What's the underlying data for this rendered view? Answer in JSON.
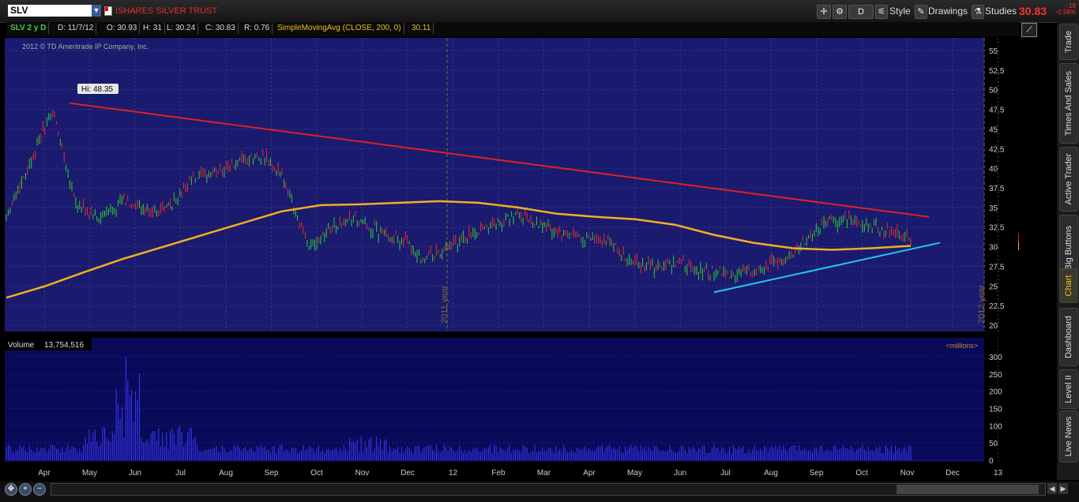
{
  "toolbar": {
    "symbol": "SLV",
    "description": "ISHARES SILVER TRUST",
    "d_button": "D",
    "style_label": "Style",
    "drawings_label": "Drawings",
    "studies_label": "Studies",
    "last_price": "30.83",
    "change": "-.18",
    "change_pct": "-0.58%"
  },
  "infobar": {
    "period": "SLV 2 y D",
    "date": "D: 11/7/12",
    "open": "O: 30.93",
    "high": "H: 31",
    "low": "L: 30.24",
    "close": "C: 30.83",
    "range": "R: 0.76",
    "study": "SimpleMovingAvg (CLOSE, 200, 0)",
    "study_value": "30.11"
  },
  "chart": {
    "copyright": "2012 © TD Ameritrade IP Company, Inc.",
    "hi_label": "Hi: 48.35",
    "year_2011": "2011 year",
    "year_2012": "2012 year",
    "price_label": "30.83",
    "sma_label": "30.11",
    "volume_label": "Volume",
    "volume_value": "13,754,516",
    "millions_label": "<millions>",
    "price_ticks": [
      "55",
      "52.5",
      "50",
      "47.5",
      "45",
      "42.5",
      "40",
      "37.5",
      "35",
      "32.5",
      "30",
      "27.5",
      "25",
      "22.5",
      "20"
    ],
    "volume_ticks": [
      "300",
      "250",
      "200",
      "150",
      "100",
      "50",
      "0"
    ],
    "x_labels": [
      "Apr",
      "May",
      "Jun",
      "Jul",
      "Aug",
      "Sep",
      "Oct",
      "Nov",
      "Dec",
      "12",
      "Feb",
      "Mar",
      "Apr",
      "May",
      "Jun",
      "Jul",
      "Aug",
      "Sep",
      "Oct",
      "Nov",
      "Dec",
      "13"
    ],
    "colors": {
      "background": "#1a1a6e",
      "grid": "#3a3a8a",
      "up": "#30d030",
      "down": "#e03030",
      "sma": "#f0b020",
      "resistance": "#e02020",
      "support": "#20c8f0",
      "volume": "#3a3aff"
    }
  },
  "chart_data": {
    "type": "line",
    "ylim": [
      20,
      56
    ],
    "hi": 48.35,
    "last": 30.83,
    "sma200_last": 30.11,
    "resistance_line": [
      {
        "x": "Apr 2011",
        "y": 48.3
      },
      {
        "x": "Nov 2012",
        "y": 33.8
      }
    ],
    "support_line": [
      {
        "x": "Jul 2012",
        "y": 24.2
      },
      {
        "x": "Nov 2012",
        "y": 30.5
      }
    ],
    "close_series": [
      {
        "x": "Mar 2011",
        "y": 34.0
      },
      {
        "x": "Apr 2011",
        "y": 40.5
      },
      {
        "x": "Apr 2011",
        "y": 47.5
      },
      {
        "x": "May 2011",
        "y": 35.5
      },
      {
        "x": "May 2011",
        "y": 33.5
      },
      {
        "x": "Jun 2011",
        "y": 36.0
      },
      {
        "x": "Jun 2011",
        "y": 34.5
      },
      {
        "x": "Jul 2011",
        "y": 35.0
      },
      {
        "x": "Jul 2011",
        "y": 38.5
      },
      {
        "x": "Aug 2011",
        "y": 39.5
      },
      {
        "x": "Aug 2011",
        "y": 40.5
      },
      {
        "x": "Sep 2011",
        "y": 41.5
      },
      {
        "x": "Sep 2011",
        "y": 38.5
      },
      {
        "x": "Oct 2011",
        "y": 30.0
      },
      {
        "x": "Oct 2011",
        "y": 32.5
      },
      {
        "x": "Nov 2011",
        "y": 33.5
      },
      {
        "x": "Nov 2011",
        "y": 32.0
      },
      {
        "x": "Dec 2011",
        "y": 31.0
      },
      {
        "x": "Dec 2011",
        "y": 28.5
      },
      {
        "x": "Jan 2012",
        "y": 29.5
      },
      {
        "x": "Jan 2012",
        "y": 31.5
      },
      {
        "x": "Feb 2012",
        "y": 33.0
      },
      {
        "x": "Feb 2012",
        "y": 34.0
      },
      {
        "x": "Mar 2012",
        "y": 33.0
      },
      {
        "x": "Mar 2012",
        "y": 31.5
      },
      {
        "x": "Apr 2012",
        "y": 31.0
      },
      {
        "x": "Apr 2012",
        "y": 30.5
      },
      {
        "x": "May 2012",
        "y": 28.0
      },
      {
        "x": "May 2012",
        "y": 27.5
      },
      {
        "x": "Jun 2012",
        "y": 28.0
      },
      {
        "x": "Jun 2012",
        "y": 27.0
      },
      {
        "x": "Jul 2012",
        "y": 26.5
      },
      {
        "x": "Jul 2012",
        "y": 26.8
      },
      {
        "x": "Aug 2012",
        "y": 27.5
      },
      {
        "x": "Aug 2012",
        "y": 29.5
      },
      {
        "x": "Sep 2012",
        "y": 32.5
      },
      {
        "x": "Sep 2012",
        "y": 33.5
      },
      {
        "x": "Oct 2012",
        "y": 33.0
      },
      {
        "x": "Oct 2012",
        "y": 32.0
      },
      {
        "x": "Nov 2012",
        "y": 30.83
      }
    ],
    "sma_series": [
      23.5,
      25.0,
      26.8,
      28.5,
      30.0,
      31.5,
      33.0,
      34.5,
      35.3,
      35.4,
      35.6,
      35.8,
      35.6,
      35.0,
      34.2,
      33.8,
      33.5,
      32.8,
      31.5,
      30.5,
      29.8,
      29.6,
      29.8,
      30.11
    ]
  }
}
